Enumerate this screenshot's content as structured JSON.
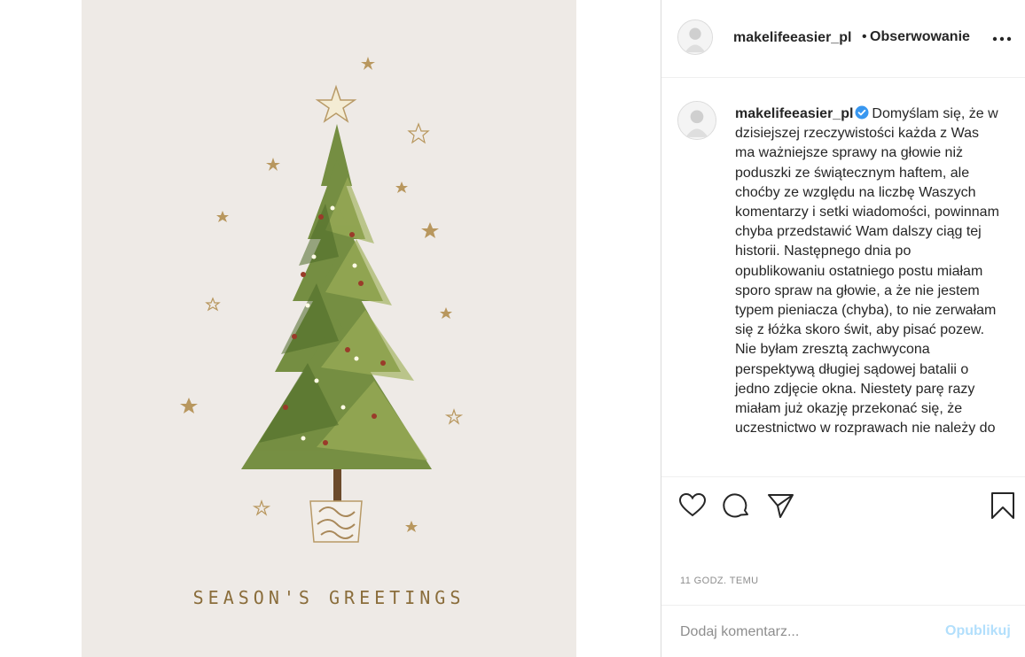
{
  "post": {
    "greeting_text": "SEASON'S GREETINGS"
  },
  "header": {
    "username": "makelifeeasier_pl",
    "separator": "•",
    "follow_label": "Obserwowanie",
    "more_icon": "more-horizontal-icon"
  },
  "caption": {
    "username": "makelifeeasier_pl",
    "verified_icon": "verified-badge-icon",
    "text": "Domyślam się, że w dzisiejszej rzeczywistości każda z Was ma ważniejsze sprawy na głowie niż poduszki ze świątecznym haftem, ale choćby ze względu na liczbę Waszych komentarzy i setki wiadomości, powinnam chyba przedstawić Wam dalszy ciąg tej historii. Następnego dnia po opublikowaniu ostatniego postu miałam sporo spraw na głowie, a że nie jestem typem pieniacza (chyba), to nie zerwałam się z łóżka skoro świt, aby pisać pozew. Nie byłam zresztą zachwycona perspektywą długiej sądowej batalii o jedno zdjęcie okna. Niestety parę razy miałam już okazję przekonać się, że uczestnictwo w rozprawach nie należy do"
  },
  "actions": {
    "icons": [
      "heart-icon",
      "comment-icon",
      "share-icon",
      "bookmark-icon"
    ]
  },
  "timestamp": "11 GODZ. TEMU",
  "comment": {
    "placeholder": "Dodaj komentarz...",
    "publish_label": "Opublikuj"
  },
  "colors": {
    "link_disabled": "#b2dffc",
    "verified": "#3897f0",
    "text": "#262626",
    "muted": "#8e8e8e"
  }
}
